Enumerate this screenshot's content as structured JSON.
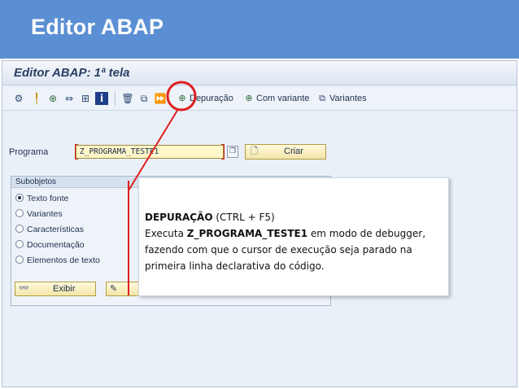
{
  "slide": {
    "title": "Editor ABAP"
  },
  "sap": {
    "window_title": "Editor ABAP: 1ª tela",
    "toolbar": {
      "icons": [
        "program-objects-icon",
        "where-used-icon",
        "check-icon",
        "move-icon",
        "hierarchy-icon",
        "info-icon",
        "delete-icon",
        "copy-icon",
        "execute-icon"
      ],
      "debug_label": "Depuração",
      "with_variant_label": "Com variante",
      "variants_label": "Variantes"
    },
    "program": {
      "label": "Programa",
      "value": "Z_PROGRAMA_TESTE1",
      "create_label": "Criar"
    },
    "subobjects": {
      "title": "Subobjetos",
      "options": [
        {
          "label": "Texto fonte",
          "selected": true
        },
        {
          "label": "Variantes",
          "selected": false
        },
        {
          "label": "Características",
          "selected": false
        },
        {
          "label": "Documentação",
          "selected": false
        },
        {
          "label": "Elementos de texto",
          "selected": false
        }
      ],
      "display_label": "Exibir"
    }
  },
  "callout": {
    "heading": "DEPURAÇÃO",
    "shortcut": " (CTRL + F5)",
    "line1_prefix": "Executa ",
    "program_name": "Z_PROGRAMA_TESTE1",
    "line1_suffix": " em modo de debugger,",
    "line2": "fazendo com que o cursor de execução seja parado na",
    "line3": "primeira linha declarativa do código."
  },
  "colors": {
    "header_bg": "#5b8fd4",
    "highlight": "#dd1f1f"
  }
}
